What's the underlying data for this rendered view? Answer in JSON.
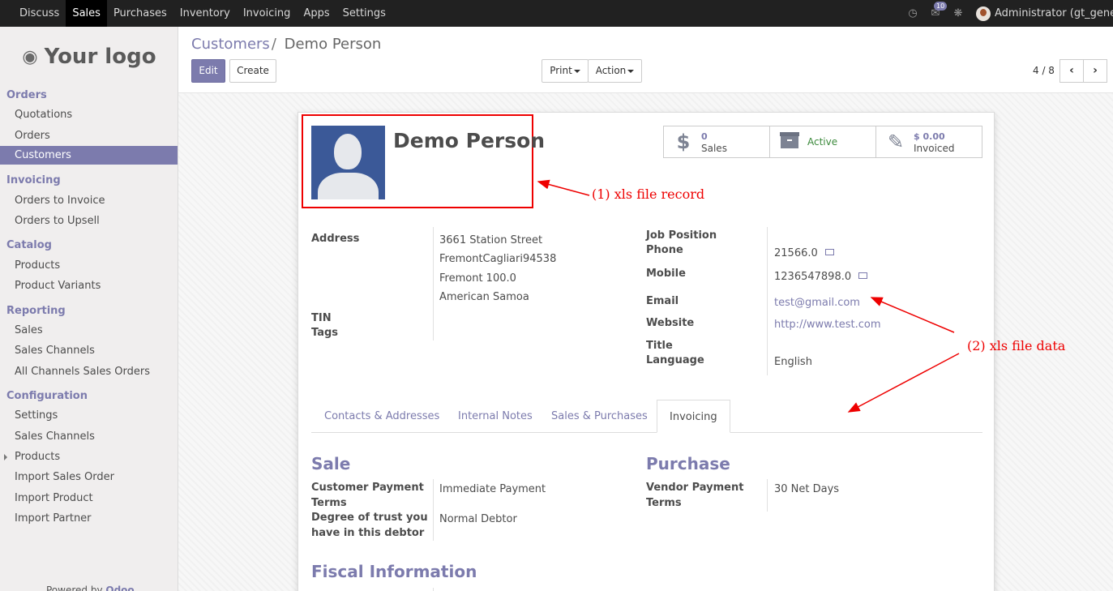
{
  "topbar": {
    "menu": [
      "Discuss",
      "Sales",
      "Purchases",
      "Inventory",
      "Invoicing",
      "Apps",
      "Settings"
    ],
    "active_menu": "Sales",
    "message_count": "10",
    "user": "Administrator (gt_gener..."
  },
  "sidebar": {
    "logo_text": "Your logo",
    "sections": [
      {
        "title": "Orders",
        "items": [
          "Quotations",
          "Orders",
          "Customers"
        ]
      },
      {
        "title": "Invoicing",
        "items": [
          "Orders to Invoice",
          "Orders to Upsell"
        ]
      },
      {
        "title": "Catalog",
        "items": [
          "Products",
          "Product Variants"
        ]
      },
      {
        "title": "Reporting",
        "items": [
          "Sales",
          "Sales Channels",
          "All Channels Sales Orders"
        ]
      },
      {
        "title": "Configuration",
        "items": [
          "Settings",
          "Sales Channels",
          "Products",
          "Import Sales Order",
          "Import Product",
          "Import Partner"
        ]
      }
    ],
    "active_item": "Customers",
    "powered_by": "Powered by",
    "powered_brand": "Odoo"
  },
  "control_panel": {
    "breadcrumb_parent": "Customers",
    "breadcrumb_sep": "/",
    "breadcrumb_current": "Demo Person",
    "edit_label": "Edit",
    "create_label": "Create",
    "print_label": "Print",
    "action_label": "Action",
    "pager": "4 / 8"
  },
  "record": {
    "name": "Demo Person",
    "smart_buttons": {
      "sales_count": "0",
      "sales_label": "Sales",
      "active_label": "Active",
      "invoiced_amount": "$ 0.00",
      "invoiced_label": "Invoiced"
    },
    "address_label": "Address",
    "address_lines": [
      "3661 Station Street",
      "FremontCagliari94538",
      "Fremont 100.0",
      "American Samoa"
    ],
    "tin_label": "TIN",
    "tags_label": "Tags",
    "job_position_label": "Job Position",
    "phone_label": "Phone",
    "phone": "21566.0",
    "mobile_label": "Mobile",
    "mobile": "1236547898.0",
    "email_label": "Email",
    "email": "test@gmail.com",
    "website_label": "Website",
    "website": "http://www.test.com",
    "title_label": "Title",
    "language_label": "Language",
    "language": "English"
  },
  "tabs": [
    "Contacts & Addresses",
    "Internal Notes",
    "Sales & Purchases",
    "Invoicing"
  ],
  "active_tab": "Invoicing",
  "invoicing_tab": {
    "sale_heading": "Sale",
    "customer_payment_terms_label_1": "Customer Payment",
    "customer_payment_terms_label_2": "Terms",
    "customer_payment_terms": "Immediate Payment",
    "trust_label_1": "Degree of trust you",
    "trust_label_2": "have in this debtor",
    "trust": "Normal Debtor",
    "purchase_heading": "Purchase",
    "vendor_payment_terms_label_1": "Vendor Payment",
    "vendor_payment_terms_label_2": "Terms",
    "vendor_payment_terms": "30 Net Days",
    "fiscal_heading": "Fiscal Information"
  },
  "annotations": {
    "note1": "(1) xls file record",
    "note2": "(2) xls file data",
    "color": "#e00000"
  },
  "colors": {
    "accent": "#7c7bad",
    "topbar": "#212121"
  }
}
